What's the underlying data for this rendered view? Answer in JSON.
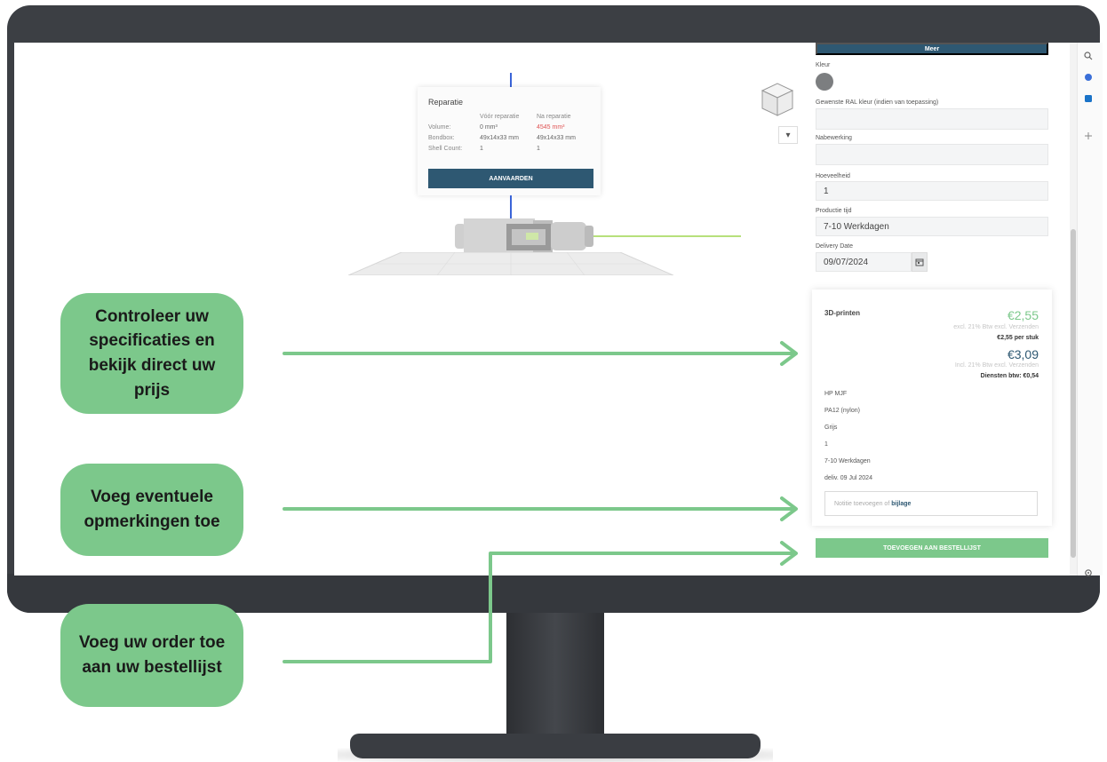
{
  "viewer": {
    "repair_card": {
      "title": "Reparatie",
      "col_before": "Vóór reparatie",
      "col_after": "Na reparatie",
      "rows": [
        {
          "label": "Volume:",
          "before": "0 mm³",
          "after": "4545 mm³"
        },
        {
          "label": "Bondbox:",
          "before": "49x14x33 mm",
          "after": "49x14x33 mm"
        },
        {
          "label": "Shell Count:",
          "before": "1",
          "after": "1"
        }
      ],
      "accept_label": "AANVAARDEN"
    },
    "dropdown_glyph": "▾",
    "nav_cube_icon": "view-cube-icon"
  },
  "panel": {
    "more_label": "Meer",
    "color_label": "Kleur",
    "color_value": "#7c7e80",
    "ral_label": "Gewenste RAL kleur (indien van toepassing)",
    "ral_value": "",
    "finishing_label": "Nabewerking",
    "finishing_value": "",
    "quantity_label": "Hoeveelheid",
    "quantity_value": "1",
    "production_label": "Productie tijd",
    "production_value": "7-10 Werkdagen",
    "delivery_label": "Delivery Date",
    "delivery_value": "09/07/2024",
    "calendar_icon": "calendar-icon"
  },
  "price": {
    "service": "3D-printen",
    "price_excl": "€2,55",
    "excl_note": "excl. 21% Btw excl. Verzenden",
    "per_piece": "€2,55 per stuk",
    "price_incl": "€3,09",
    "incl_note": "Incl. 21% Btw excl. Verzenden",
    "vat": "Diensten btw: €0,54",
    "specs": [
      "HP MJF",
      "PA12 (nylon)",
      "Grijs",
      "1",
      "7-10 Werkdagen",
      "deliv. 09 Jul 2024"
    ],
    "remarks_placeholder": "Notitie toevoegen of",
    "remarks_link": "bijlage",
    "add_label": "TOEVOEGEN AAN BESTELLIJST"
  },
  "callouts": [
    "Controleer uw\nspecificaties en\nbekijk direct uw\nprijs",
    "Voeg eventuele\nopmerkingen toe",
    "Voeg uw order toe\naan uw bestellijst"
  ],
  "colors": {
    "accent_green": "#7cc88b",
    "primary_blue": "#2e5872",
    "arrow_green": "#7cc88b"
  },
  "toolbar_icons": [
    "search-icon",
    "extension-icon",
    "outlook-icon",
    "add-icon",
    "settings-icon"
  ]
}
